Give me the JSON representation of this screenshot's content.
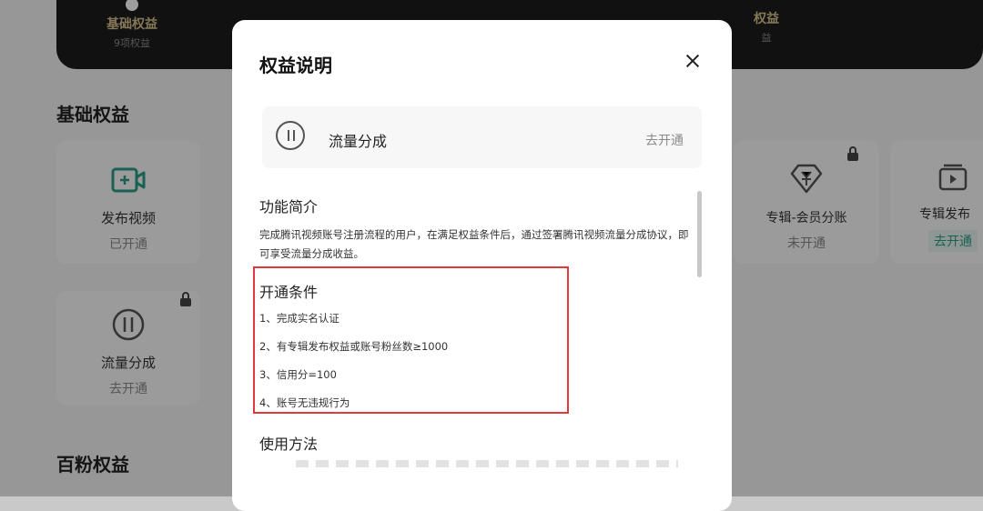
{
  "background": {
    "header": {
      "basic_label": "基础权益",
      "basic_count": "9项权益",
      "right_label": "权益",
      "right_count": "益"
    },
    "section_basic": "基础权益",
    "section_hundred_fans": "百粉权益",
    "cards": [
      {
        "name": "发布视频",
        "status": "已开通"
      },
      {
        "name": "流量分成",
        "status": "去开通"
      },
      {
        "name": "专辑-会员分账",
        "status": "未开通"
      },
      {
        "name": "专辑发布",
        "status": "去开通"
      }
    ]
  },
  "modal": {
    "title": "权益说明",
    "feature": {
      "name": "流量分成",
      "action": "去开通"
    },
    "intro_title": "功能简介",
    "intro_text": "完成腾讯视频账号注册流程的用户，在满足权益条件后，通过签署腾讯视频流量分成协议，即可享受流量分成收益。",
    "conditions_title": "开通条件",
    "conditions": [
      "1、完成实名认证",
      "2、有专辑发布权益或账号粉丝数≥1000",
      "3、信用分=100",
      "4、账号无违规行为"
    ],
    "usage_title": "使用方法"
  },
  "colors": {
    "highlight_border": "#e23a3a",
    "header_bg": "#1c1c1e",
    "accent_teal": "#2b9d87"
  }
}
